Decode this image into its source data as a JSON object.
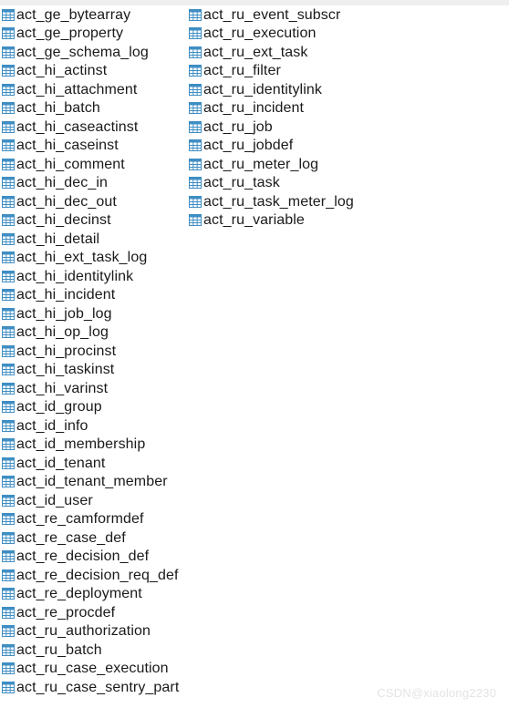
{
  "window": {
    "title": "Database Table List",
    "background_color": "#ffffff",
    "top_band_color": "#efefef"
  },
  "icons": {
    "table_icon_name": "table-grid-icon",
    "table_icon_color": "#3f8ec4",
    "table_icon_fill": "#ffffff"
  },
  "watermark": {
    "text": "CSDN@xiaolong2230",
    "color": "#e4e4e4"
  },
  "table_list": {
    "columns": [
      {
        "id": "column-left",
        "items": [
          {
            "name": "act_ge_bytearray"
          },
          {
            "name": "act_ge_property"
          },
          {
            "name": "act_ge_schema_log"
          },
          {
            "name": "act_hi_actinst"
          },
          {
            "name": "act_hi_attachment"
          },
          {
            "name": "act_hi_batch"
          },
          {
            "name": "act_hi_caseactinst"
          },
          {
            "name": "act_hi_caseinst"
          },
          {
            "name": "act_hi_comment"
          },
          {
            "name": "act_hi_dec_in"
          },
          {
            "name": "act_hi_dec_out"
          },
          {
            "name": "act_hi_decinst"
          },
          {
            "name": "act_hi_detail"
          },
          {
            "name": "act_hi_ext_task_log"
          },
          {
            "name": "act_hi_identitylink"
          },
          {
            "name": "act_hi_incident"
          },
          {
            "name": "act_hi_job_log"
          },
          {
            "name": "act_hi_op_log"
          },
          {
            "name": "act_hi_procinst"
          },
          {
            "name": "act_hi_taskinst"
          },
          {
            "name": "act_hi_varinst"
          },
          {
            "name": "act_id_group"
          },
          {
            "name": "act_id_info"
          },
          {
            "name": "act_id_membership"
          },
          {
            "name": "act_id_tenant"
          },
          {
            "name": "act_id_tenant_member"
          },
          {
            "name": "act_id_user"
          },
          {
            "name": "act_re_camformdef"
          },
          {
            "name": "act_re_case_def"
          },
          {
            "name": "act_re_decision_def"
          },
          {
            "name": "act_re_decision_req_def"
          },
          {
            "name": "act_re_deployment"
          },
          {
            "name": "act_re_procdef"
          },
          {
            "name": "act_ru_authorization"
          },
          {
            "name": "act_ru_batch"
          },
          {
            "name": "act_ru_case_execution"
          },
          {
            "name": "act_ru_case_sentry_part"
          }
        ]
      },
      {
        "id": "column-right",
        "items": [
          {
            "name": "act_ru_event_subscr"
          },
          {
            "name": "act_ru_execution"
          },
          {
            "name": "act_ru_ext_task"
          },
          {
            "name": "act_ru_filter"
          },
          {
            "name": "act_ru_identitylink"
          },
          {
            "name": "act_ru_incident"
          },
          {
            "name": "act_ru_job"
          },
          {
            "name": "act_ru_jobdef"
          },
          {
            "name": "act_ru_meter_log"
          },
          {
            "name": "act_ru_task"
          },
          {
            "name": "act_ru_task_meter_log"
          },
          {
            "name": "act_ru_variable"
          }
        ]
      }
    ]
  }
}
